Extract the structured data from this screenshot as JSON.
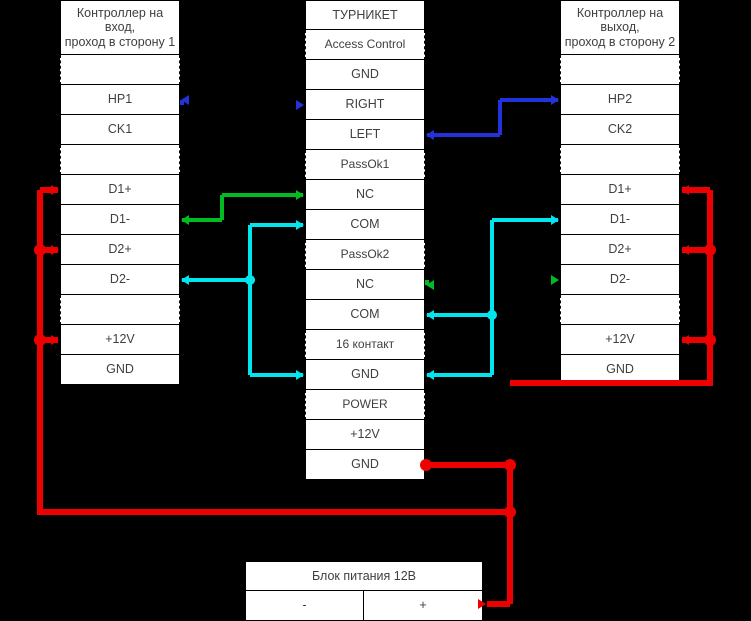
{
  "colors": {
    "blue": "#2233dd",
    "green": "#00bb22",
    "cyan": "#00e5ee",
    "red": "#ee0000",
    "black": "#000000",
    "white": "#ffffff",
    "text": "#404040"
  },
  "left_table": {
    "title": "Контроллер на вход,\nпроход в сторону 1",
    "rows": [
      {
        "label": "Контроллер на вход,\nпроход в сторону 1",
        "type": "header"
      },
      {
        "label": "",
        "type": "blank"
      },
      {
        "label": "HP1",
        "type": "term"
      },
      {
        "label": "CK1",
        "type": "term"
      },
      {
        "label": "",
        "type": "blank"
      },
      {
        "label": "D1+",
        "type": "term"
      },
      {
        "label": "D1-",
        "type": "term"
      },
      {
        "label": "D2+",
        "type": "term"
      },
      {
        "label": "D2-",
        "type": "term"
      },
      {
        "label": "",
        "type": "blank"
      },
      {
        "label": "+12V",
        "type": "term"
      },
      {
        "label": "GND",
        "type": "term"
      }
    ]
  },
  "middle_table": {
    "title": "ТУРНИКЕТ",
    "rows": [
      {
        "label": "ТУРНИКЕТ",
        "type": "header"
      },
      {
        "label": "Access Control",
        "type": "group"
      },
      {
        "label": "GND",
        "type": "term"
      },
      {
        "label": "RIGHT",
        "type": "term"
      },
      {
        "label": "LEFT",
        "type": "term"
      },
      {
        "label": "PassOk1",
        "type": "group"
      },
      {
        "label": "NC",
        "type": "term"
      },
      {
        "label": "COM",
        "type": "term"
      },
      {
        "label": "PassOk2",
        "type": "group"
      },
      {
        "label": "NC",
        "type": "term"
      },
      {
        "label": "COM",
        "type": "term"
      },
      {
        "label": "16 контакт",
        "type": "group"
      },
      {
        "label": "GND",
        "type": "term"
      },
      {
        "label": "POWER",
        "type": "group"
      },
      {
        "label": "+12V",
        "type": "term"
      },
      {
        "label": "GND",
        "type": "term"
      }
    ]
  },
  "right_table": {
    "title": "Контроллер на\nвыход,\nпроход в сторону 2",
    "rows": [
      {
        "label": "Контроллер на\nвыход,\nпроход в сторону 2",
        "type": "header"
      },
      {
        "label": "",
        "type": "blank"
      },
      {
        "label": "HP2",
        "type": "term"
      },
      {
        "label": "CK2",
        "type": "term"
      },
      {
        "label": "",
        "type": "blank"
      },
      {
        "label": "D1+",
        "type": "term"
      },
      {
        "label": "D1-",
        "type": "term"
      },
      {
        "label": "D2+",
        "type": "term"
      },
      {
        "label": "D2-",
        "type": "term"
      },
      {
        "label": "",
        "type": "blank"
      },
      {
        "label": "+12V",
        "type": "term"
      },
      {
        "label": "GND",
        "type": "term"
      }
    ]
  },
  "psu_table": {
    "title": "Блок питания 12В",
    "minus": "-",
    "plus": "+"
  }
}
